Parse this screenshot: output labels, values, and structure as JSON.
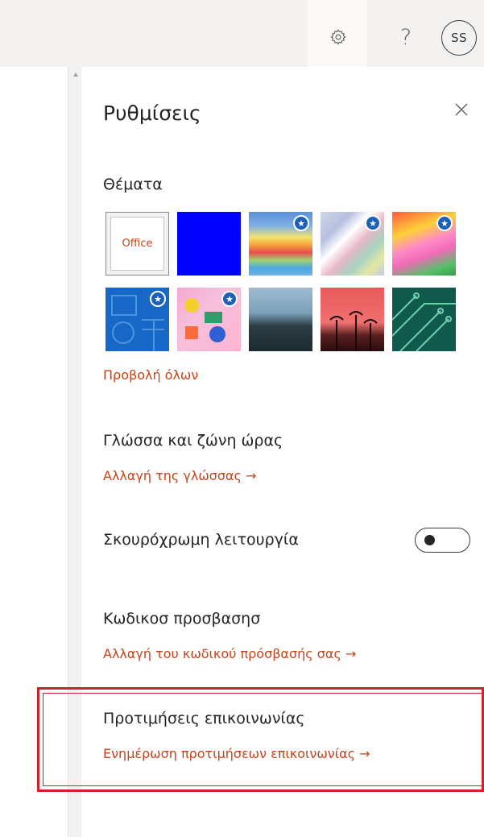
{
  "header": {
    "settings_icon": "gear-icon",
    "help_label": "?",
    "avatar_initials": "SS"
  },
  "panel": {
    "title": "Ρυθμίσεις",
    "close_label": "×",
    "themes": {
      "heading": "Θέματα",
      "office_label": "Office",
      "view_all": "Προβολή όλων",
      "items": [
        {
          "name": "office",
          "selected": true,
          "premium": false
        },
        {
          "name": "blue",
          "color": "#0000ff",
          "premium": false
        },
        {
          "name": "rainbow-waves",
          "premium": true
        },
        {
          "name": "light-rays",
          "premium": true
        },
        {
          "name": "unicorn",
          "premium": true
        },
        {
          "name": "blueprint",
          "premium": true
        },
        {
          "name": "pink-pattern",
          "premium": false
        },
        {
          "name": "mountain",
          "premium": false
        },
        {
          "name": "palm-sunset",
          "premium": false
        },
        {
          "name": "circuit",
          "premium": false
        }
      ]
    },
    "language": {
      "heading": "Γλώσσα και ζώνη ώρας",
      "link": "Αλλαγή της γλώσσας →"
    },
    "dark_mode": {
      "label": "Σκουρόχρωμη λειτουργία",
      "enabled": false
    },
    "password": {
      "heading": "Κωδικοσ προσβασησ",
      "link": "Αλλαγή του κωδικού πρόσβασής σας →"
    },
    "communication": {
      "heading": "Προτιμήσεις επικοινωνίας",
      "link": "Ενημέρωση προτιμήσεων επικοινωνίας →"
    }
  },
  "colors": {
    "accent_link": "#c4451b",
    "highlight": "#d0202a"
  }
}
